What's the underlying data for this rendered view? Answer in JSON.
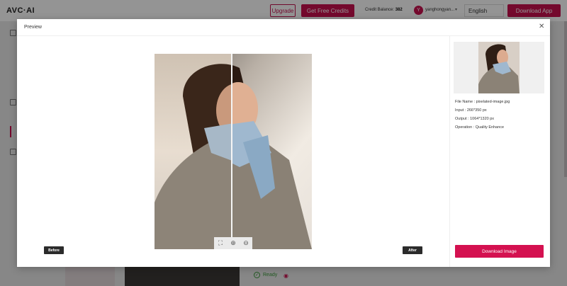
{
  "header": {
    "logo": "AVC·AI",
    "upgrade_label": "Upgrade",
    "credits_label": "Get Free Credits",
    "credit_balance_label": "Credit Balance:",
    "credit_balance_value": "382",
    "avatar_initial": "Y",
    "username": "yanghongyan...",
    "language": "English",
    "download_app_label": "Download App"
  },
  "background": {
    "status": "Ready"
  },
  "modal": {
    "title": "Preview",
    "before_label": "Before",
    "after_label": "After",
    "zoom_tools": [
      "fit-screen-icon",
      "zoom-in-icon",
      "zoom-out-icon"
    ],
    "info": {
      "file_name": "File Name : pixelated-image.jpg",
      "input": "Input : 266*350 px",
      "output": "Output : 1064*1320 px",
      "operation": "Operation : Quality Enhance"
    },
    "download_label": "Download Image"
  },
  "colors": {
    "accent": "#c8114f",
    "dark_label": "#2b2b2b",
    "overlay": "rgba(0,0,0,0.42)"
  }
}
